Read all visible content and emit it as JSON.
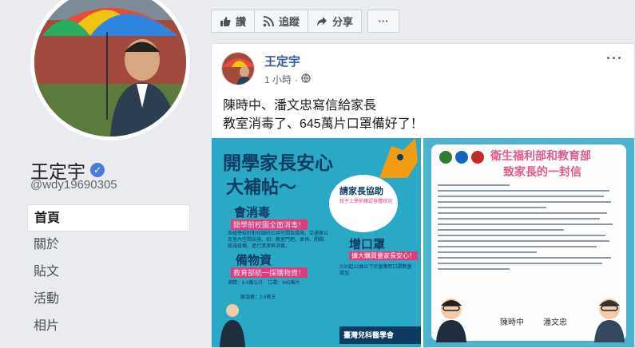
{
  "profile": {
    "name": "王定宇",
    "handle": "@wdy19690305",
    "verified_icon": "verified-badge-icon"
  },
  "nav": {
    "items": [
      {
        "label": "首頁",
        "active": true
      },
      {
        "label": "關於",
        "active": false
      },
      {
        "label": "貼文",
        "active": false
      },
      {
        "label": "活動",
        "active": false
      },
      {
        "label": "相片",
        "active": false
      }
    ]
  },
  "actions": {
    "like_label": "讚",
    "follow_label": "追蹤",
    "share_label": "分享",
    "more_label": "···"
  },
  "post": {
    "author": "王定宇",
    "time": "1 小時",
    "menu_label": "···",
    "line1": "陳時中、潘文忠寫信給家長",
    "line2": "教室消毒了、645萬片口罩備好了！"
  },
  "poster_left": {
    "title1": "開學家長安心",
    "title2": "大補帖～",
    "sec1": "會消毒",
    "sec1_sub": "開學前校園全面消毒！",
    "sec1_body": "各級學校針對校園的公共空間及環境、交通車以及室內空間設施，如：教室門把、桌椅、開關、設施設備，進行清潔與消毒。",
    "sec2": "備物資",
    "sec2_sub": "教育部統一採購物資！",
    "sec2_body1": "酒精：8.4萬公升　口罩：645萬片",
    "sec2_body2": "額溫槍：2.5萬支",
    "bubble_title": "請家長協助",
    "bubble_sub": "孩子上學前確認身體狀況",
    "mask_h": "增口罩",
    "mask_sub": "擴大購買量家長安心！",
    "mask_body": "2/20起12歲以下兒童購買口罩數量增加",
    "footer": "臺灣兒科醫學會"
  },
  "poster_right": {
    "title1": "衛生福利部和教育部",
    "title2": "致家長的一封信",
    "sig1": "陳時中",
    "sig2": "潘文忠"
  },
  "colors": {
    "fb_blue": "#365899",
    "poster_teal": "#2aa9c7",
    "poster_navy": "#0e3b62",
    "poster_pink": "#e23b7a",
    "letter_pink": "#e05a86"
  }
}
